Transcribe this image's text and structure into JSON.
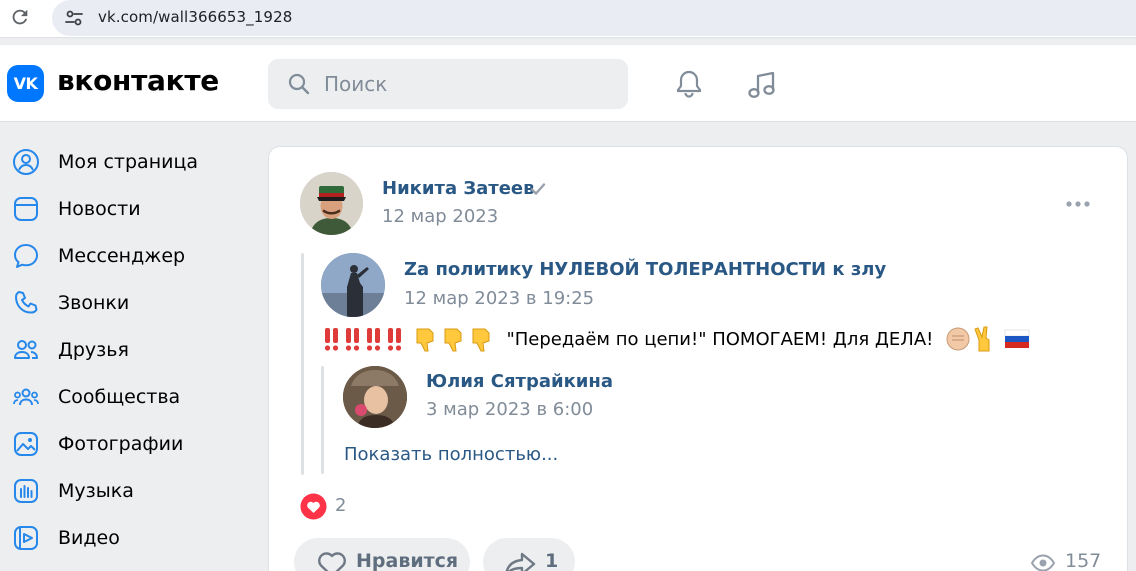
{
  "browser": {
    "url": "vk.com/wall366653_1928"
  },
  "header": {
    "logo_text": "VK",
    "brand": "вконтакте",
    "search_placeholder": "Поиск"
  },
  "sidebar": {
    "items": [
      {
        "label": "Моя страница",
        "icon": "profile-icon"
      },
      {
        "label": "Новости",
        "icon": "news-icon"
      },
      {
        "label": "Мессенджер",
        "icon": "messenger-icon"
      },
      {
        "label": "Звонки",
        "icon": "phone-icon"
      },
      {
        "label": "Друзья",
        "icon": "friends-icon"
      },
      {
        "label": "Сообщества",
        "icon": "communities-icon"
      },
      {
        "label": "Фотографии",
        "icon": "photos-icon"
      },
      {
        "label": "Музыка",
        "icon": "music-icon"
      },
      {
        "label": "Видео",
        "icon": "video-icon"
      }
    ]
  },
  "post": {
    "author": "Никита Затеев",
    "date": "12 мар 2023",
    "repost": {
      "group_name": "Zа политику НУЛЕВОЙ ТОЛЕРАНТНОСТИ к злу",
      "date": "12 мар 2023 в 19:25",
      "text": "\"Передаём по цепи!\" ПОМОГАЕМ! Для ДЕЛА!",
      "inner": {
        "author": "Юлия Сятрайкина",
        "date": "3 мар 2023 в 6:00",
        "show_more": "Показать полностью..."
      }
    },
    "reactions_count": "2",
    "like_label": "Нравится",
    "share_count": "1",
    "views": "157"
  },
  "colors": {
    "accent": "#0077ff",
    "link": "#2a5885",
    "secondary_text": "#818c99",
    "page_bg": "#edeef0",
    "heart": "#ff3347"
  }
}
